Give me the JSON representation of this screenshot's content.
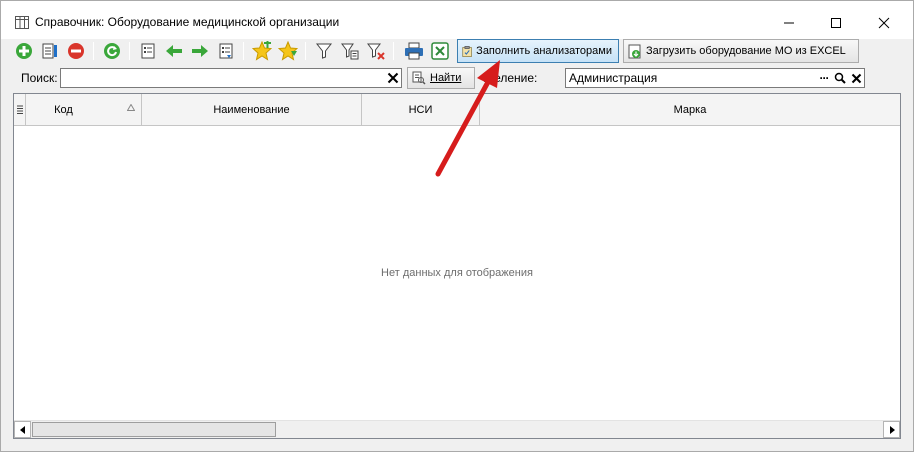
{
  "window": {
    "title": "Справочник: Оборудование медицинской организации",
    "minimize_icon": "minimize-icon",
    "maximize_icon": "maximize-icon",
    "close_icon": "close-icon"
  },
  "toolbar": {
    "icons": [
      "add-icon",
      "edit-icon",
      "delete-icon",
      "refresh-icon",
      "view-icon",
      "arrow-left-icon",
      "arrow-right-icon",
      "view-alt-icon",
      "star-add-icon",
      "star-down-icon",
      "filter-icon",
      "filter-edit-icon",
      "filter-clear-icon",
      "print-icon",
      "excel-icon"
    ],
    "fill_analyzers_label": "Заполнить анализаторами",
    "load_excel_label": "Загрузить оборудование МО из EXCEL"
  },
  "search": {
    "label": "Поиск:",
    "value": "",
    "find_label": "Найти",
    "department_label": "тделение:",
    "department_value": "Администрация"
  },
  "grid": {
    "columns": [
      "Код",
      "Наименование",
      "НСИ",
      "Марка"
    ],
    "empty_text": "Нет данных для отображения"
  },
  "colors": {
    "accent": "#3c7fb1",
    "annotation_arrow": "#d61c1c"
  }
}
